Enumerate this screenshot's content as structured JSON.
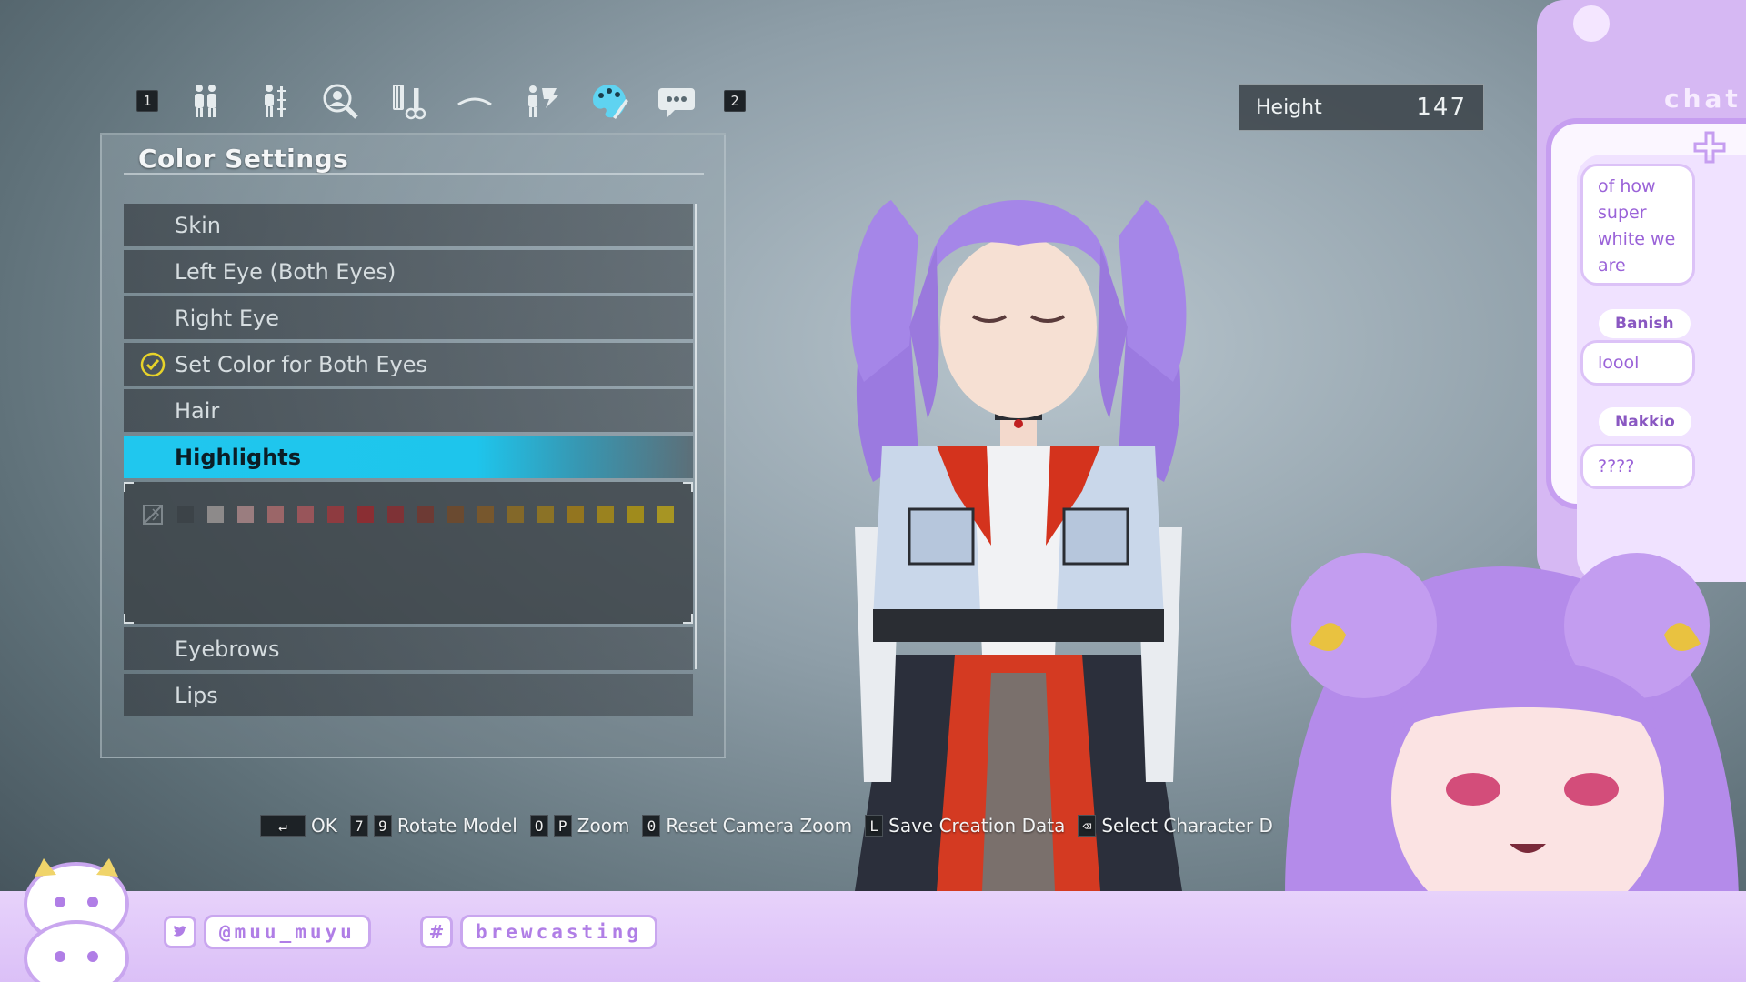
{
  "category_bar": {
    "left_key": "1",
    "right_key": "2",
    "icons": [
      "body-type-icon",
      "body-shape-icon",
      "face-search-icon",
      "hairstyle-icon",
      "eyebrow-icon",
      "accessory-icon",
      "palette-icon",
      "speech-bubble-icon"
    ],
    "active_index": 6
  },
  "panel": {
    "title": "Color Settings",
    "items": [
      {
        "label": "Skin"
      },
      {
        "label": "Left Eye (Both Eyes)"
      },
      {
        "label": "Right Eye"
      },
      {
        "label": "Set Color for Both Eyes",
        "checked": true
      },
      {
        "label": "Hair"
      },
      {
        "label": "Highlights",
        "selected": true
      },
      {
        "label": "Eyebrows"
      },
      {
        "label": "Lips"
      }
    ],
    "swatches": [
      "#3c4348",
      "#8d8a8a",
      "#9a7d7f",
      "#9b6668",
      "#98555a",
      "#8e3b40",
      "#8a2e33",
      "#7e3236",
      "#6d3a34",
      "#6a4a30",
      "#77572d",
      "#836829",
      "#8b7226",
      "#93751f",
      "#9a821f",
      "#a08b1c",
      "#a79523"
    ],
    "highlight_color": "#1ec5ec",
    "check_color": "#e7d32a"
  },
  "height": {
    "label": "Height",
    "value": "147"
  },
  "hints": [
    {
      "keys": [
        "↵"
      ],
      "label": "OK"
    },
    {
      "keys": [
        "7",
        "9"
      ],
      "label": "Rotate Model"
    },
    {
      "keys": [
        "O",
        "P"
      ],
      "label": "Zoom"
    },
    {
      "keys": [
        "0"
      ],
      "label": "Reset Camera Zoom"
    },
    {
      "keys": [
        "L"
      ],
      "label": "Save Creation Data"
    },
    {
      "keys": [
        "⌫"
      ],
      "label": "Select Character D"
    }
  ],
  "chat": {
    "header": "chat",
    "messages": [
      {
        "text": "of how super white we are"
      },
      {
        "user": "Banish",
        "text": "loool"
      },
      {
        "user": "Nakkio",
        "text": "????"
      }
    ]
  },
  "banner": {
    "twitter": "@muu_muyu",
    "hashtag": "brewcasting",
    "hash_symbol": "#"
  }
}
